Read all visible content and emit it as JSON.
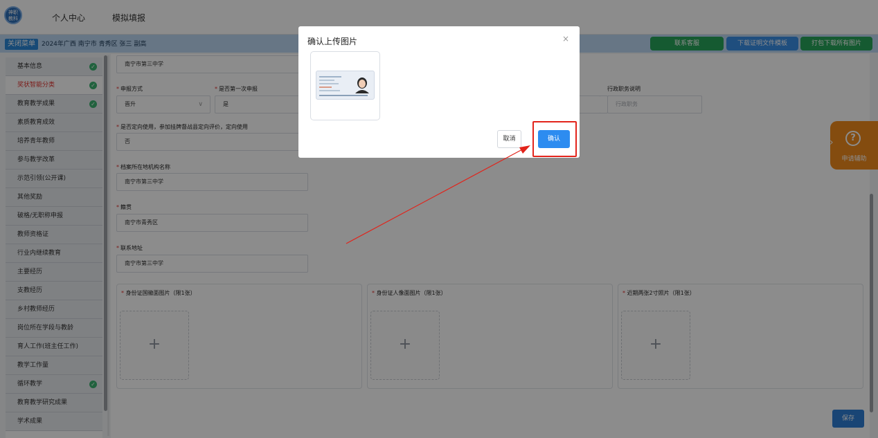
{
  "header": {
    "logo_text": "神职 教科",
    "nav": [
      "个人中心",
      "模拟填报"
    ]
  },
  "toolbar": {
    "close_menu": "关闭菜单",
    "breadcrumb": "2024年广西 南宁市 青秀区 张三 副高",
    "buttons": [
      {
        "label": "联系客服",
        "color": "#27a55a"
      },
      {
        "label": "下载证明文件模板",
        "color": "#3a8ee6"
      },
      {
        "label": "打包下载所有图片",
        "color": "#27a55a"
      }
    ]
  },
  "sidebar": {
    "items": [
      {
        "label": "基本信息",
        "checked": true,
        "active": false
      },
      {
        "label": "奖状智能分类",
        "checked": true,
        "active": true
      },
      {
        "label": "教育教学成果",
        "checked": true,
        "active": false
      },
      {
        "label": "素质教育成效",
        "checked": false,
        "active": false
      },
      {
        "label": "培养青年教师",
        "checked": false,
        "active": false
      },
      {
        "label": "参与教学改革",
        "checked": false,
        "active": false
      },
      {
        "label": "示范引领(公开课)",
        "checked": false,
        "active": false
      },
      {
        "label": "其他奖励",
        "checked": false,
        "active": false
      },
      {
        "label": "破格/无职称申报",
        "checked": false,
        "active": false
      },
      {
        "label": "教师资格证",
        "checked": false,
        "active": false
      },
      {
        "label": "行业内继续教育",
        "checked": false,
        "active": false
      },
      {
        "label": "主要经历",
        "checked": false,
        "active": false
      },
      {
        "label": "支教经历",
        "checked": false,
        "active": false
      },
      {
        "label": "乡村教师经历",
        "checked": false,
        "active": false
      },
      {
        "label": "岗位所在学段与教龄",
        "checked": false,
        "active": false
      },
      {
        "label": "育人工作(班主任工作)",
        "checked": false,
        "active": false
      },
      {
        "label": "教学工作量",
        "checked": false,
        "active": false
      },
      {
        "label": "循环教学",
        "checked": true,
        "active": false
      },
      {
        "label": "教育教学研究成果",
        "checked": false,
        "active": false
      },
      {
        "label": "学术成果",
        "checked": false,
        "active": false
      }
    ]
  },
  "form": {
    "school_value": "南宁市第三中学",
    "apply_method_label": "申报方式",
    "apply_method_value": "晋升",
    "first_apply_label": "是否第一次申报",
    "first_apply_value": "是",
    "admin_duty_label": "行政职务说明",
    "admin_duty_placeholder": "行政职务",
    "directed_label": "是否定向使用，参加挂牌督战县定向评价，定向使用",
    "directed_value": "否",
    "archive_label": "档案所在地机构名称",
    "archive_value": "南宁市第三中学",
    "origin_label": "籍贯",
    "origin_value": "南宁市青秀区",
    "address_label": "联系地址",
    "address_value": "南宁市第三中学",
    "uploads": [
      {
        "title": "身份证国徽面图片（限1张）"
      },
      {
        "title": "身份证人像面图片（限1张）"
      },
      {
        "title": "近期两张2寸照片（限1张）"
      }
    ],
    "upload_plus": "+",
    "save": "保存"
  },
  "help": {
    "icon": "question-icon",
    "icon_glyph": "?",
    "chevron": "›",
    "label": "申请辅助",
    "color": "#f08b1d"
  },
  "dialog": {
    "title": "确认上传图片",
    "close": "×",
    "cancel": "取消",
    "confirm": "确认"
  },
  "annotation": {
    "color": "#e2231a"
  }
}
